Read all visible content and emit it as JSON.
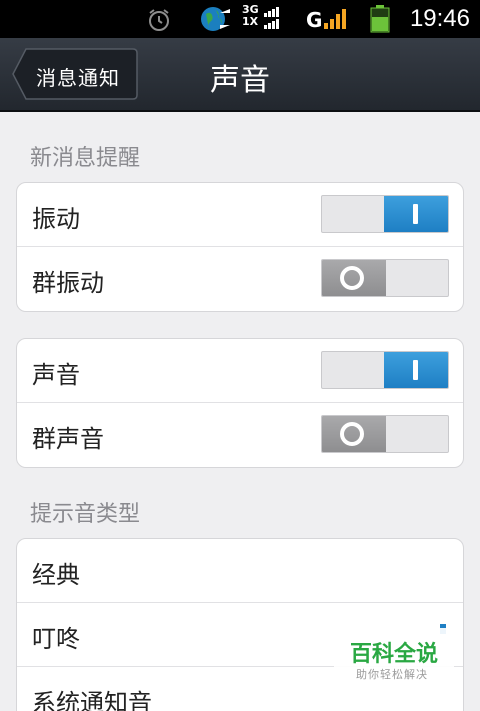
{
  "status_bar": {
    "time": "19:46",
    "icons": [
      "alarm-icon",
      "globe-sync-icon",
      "network-3g-1x-icon",
      "signal-icon",
      "battery-icon"
    ],
    "net_top": "3G",
    "net_bottom": "1X",
    "signal_letter": "G"
  },
  "title_bar": {
    "back_label": "消息通知",
    "title": "声音"
  },
  "sections": {
    "new_message_alert": "新消息提醒",
    "alert_sound_type": "提示音类型"
  },
  "vibration_card": {
    "rows": [
      {
        "label": "振动",
        "on": true
      },
      {
        "label": "群振动",
        "on": false
      }
    ]
  },
  "sound_card": {
    "rows": [
      {
        "label": "声音",
        "on": true
      },
      {
        "label": "群声音",
        "on": false
      }
    ]
  },
  "sound_type_card": {
    "rows": [
      {
        "label": "经典"
      },
      {
        "label": "叮咚"
      },
      {
        "label": "系统通知音"
      }
    ]
  },
  "watermark": {
    "title": "百科全说",
    "subtitle": "助你轻松解决"
  },
  "colors": {
    "accent_blue": "#2389cf",
    "toggle_off": "#9b9b9d",
    "section_text": "#8a8a8f",
    "titlebar": "#2a2f37",
    "watermark_green": "#2aa843"
  }
}
